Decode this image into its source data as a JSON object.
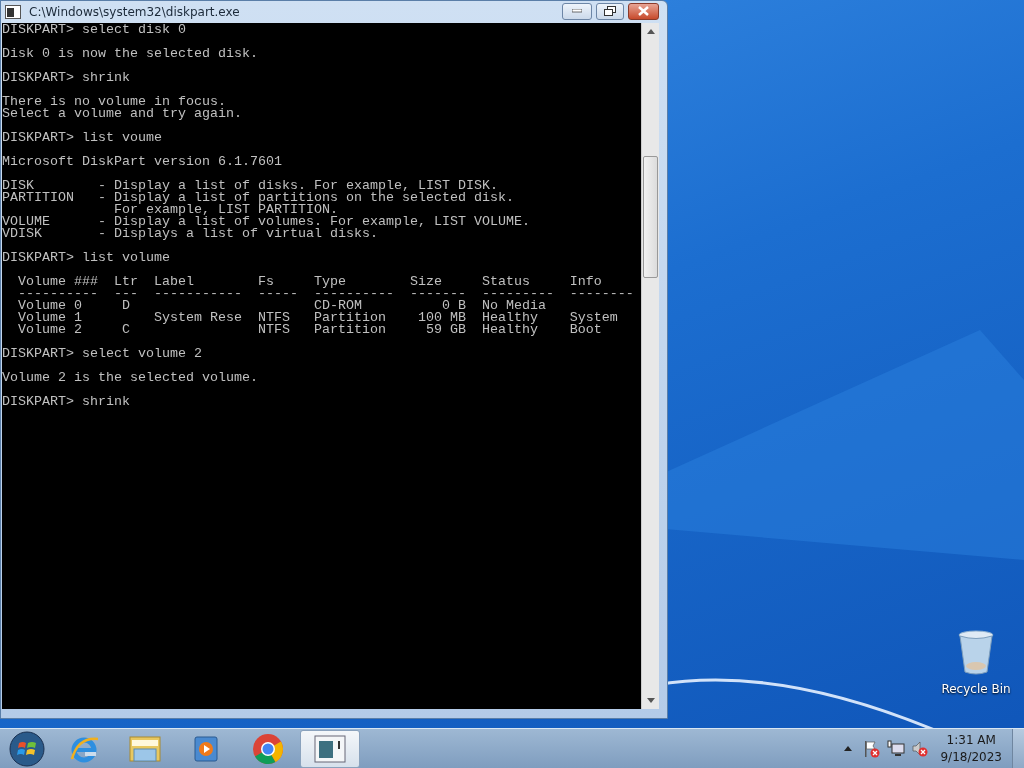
{
  "window": {
    "title": "C:\\Windows\\system32\\diskpart.exe"
  },
  "console": {
    "blocks": [
      [
        "DISKPART> select disk 0"
      ],
      [
        "Disk 0 is now the selected disk."
      ],
      [
        "DISKPART> shrink"
      ],
      [
        "There is no volume in focus.",
        "Select a volume and try again."
      ],
      [
        "DISKPART> list voume"
      ],
      [
        "Microsoft DiskPart version 6.1.7601"
      ],
      [
        "DISK        - Display a list of disks. For example, LIST DISK.",
        "PARTITION   - Display a list of partitions on the selected disk.",
        "              For example, LIST PARTITION.",
        "VOLUME      - Display a list of volumes. For example, LIST VOLUME.",
        "VDISK       - Displays a list of virtual disks."
      ],
      [
        "DISKPART> list volume"
      ],
      [
        "  Volume ###  Ltr  Label        Fs     Type        Size     Status     Info",
        "  ----------  ---  -----------  -----  ----------  -------  ---------  --------",
        "  Volume 0     D                       CD-ROM          0 B  No Media",
        "  Volume 1         System Rese  NTFS   Partition    100 MB  Healthy    System",
        "  Volume 2     C                NTFS   Partition     59 GB  Healthy    Boot"
      ],
      [
        "DISKPART> select volume 2"
      ],
      [
        "Volume 2 is the selected volume."
      ],
      [
        "DISKPART> shrink"
      ]
    ]
  },
  "desktop_icons": [
    {
      "kind": "recycle-bin",
      "label": "Recycle Bin"
    }
  ],
  "taskbar": {
    "buttons": [
      {
        "kind": "start",
        "selected": false
      },
      {
        "kind": "browser-e",
        "selected": false
      },
      {
        "kind": "folder",
        "selected": false
      },
      {
        "kind": "media",
        "selected": false
      },
      {
        "kind": "chrome",
        "selected": false
      },
      {
        "kind": "console",
        "selected": true
      }
    ],
    "tray": [
      {
        "kind": "arrow"
      },
      {
        "kind": "flag"
      },
      {
        "kind": "network"
      },
      {
        "kind": "speaker"
      }
    ],
    "clock": {
      "time": "1:31 AM",
      "date": "9/18/2023"
    }
  }
}
